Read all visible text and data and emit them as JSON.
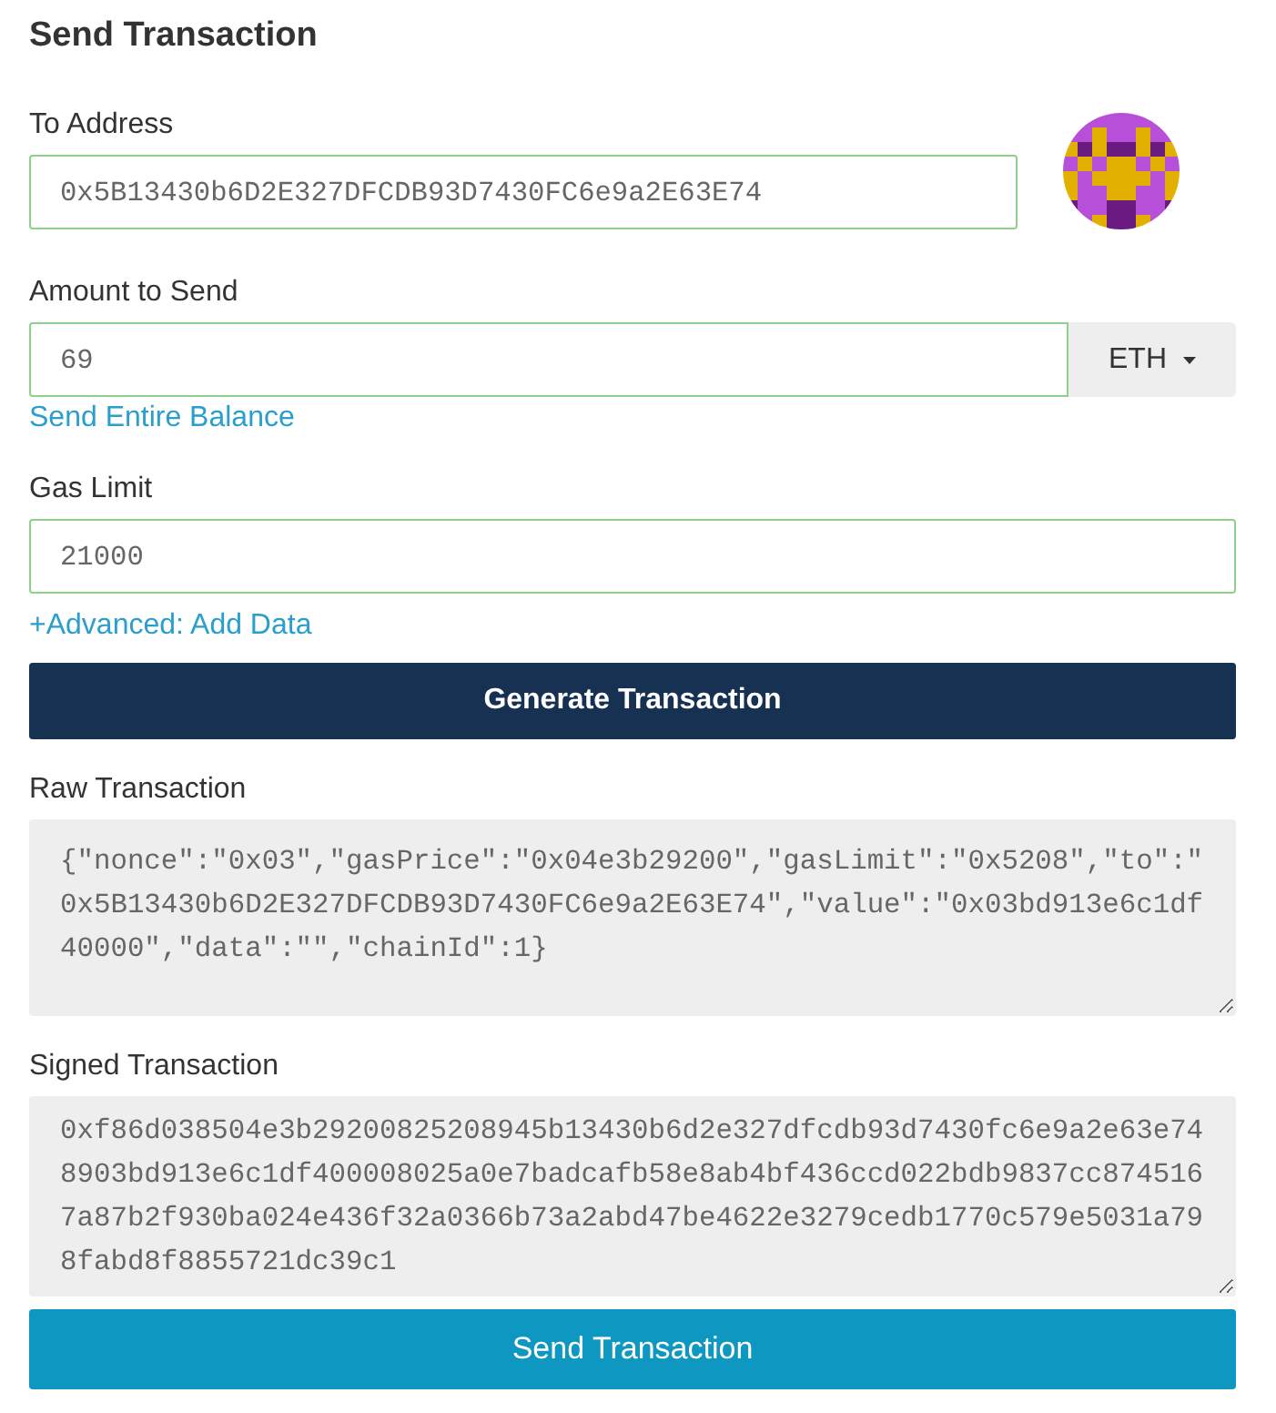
{
  "title": "Send Transaction",
  "to_address": {
    "label": "To Address",
    "value": "0x5B13430b6D2E327DFCDB93D7430FC6e9a2E63E74",
    "valid": true
  },
  "amount": {
    "label": "Amount to Send",
    "value": "69",
    "valid": true,
    "unit": "ETH",
    "link": "Send Entire Balance"
  },
  "gas_limit": {
    "label": "Gas Limit",
    "value": "21000",
    "valid": true,
    "link": "+Advanced: Add Data"
  },
  "generate_button": "Generate Transaction",
  "raw_transaction": {
    "label": "Raw Transaction",
    "value": "{\"nonce\":\"0x03\",\"gasPrice\":\"0x04e3b29200\",\"gasLimit\":\"0x5208\",\"to\":\"0x5B13430b6D2E327DFCDB93D7430FC6e9a2E63E74\",\"value\":\"0x03bd913e6c1df40000\",\"data\":\"\",\"chainId\":1}"
  },
  "signed_transaction": {
    "label": "Signed Transaction",
    "value": "0xf86d038504e3b29200825208945b13430b6d2e327dfcdb93d7430fc6e9a2e63e748903bd913e6c1df400008025a0e7badcafb58e8ab4bf436ccd022bdb9837cc8745167a87b2f930ba024e436f32a0366b73a2abd47be4622e3279cedb1770c579e5031a798fabd8f8855721dc39c1"
  },
  "send_button": "Send Transaction"
}
